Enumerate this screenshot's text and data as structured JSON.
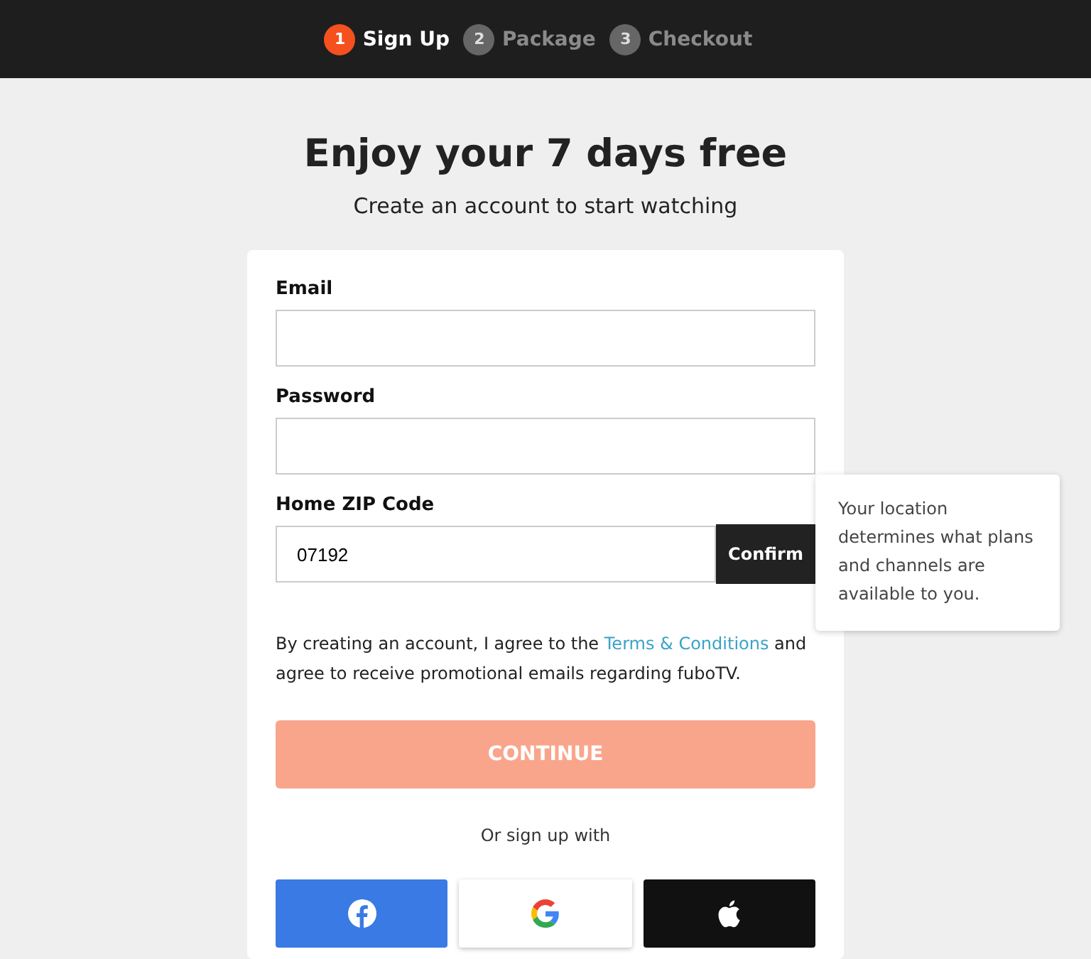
{
  "steps": [
    {
      "number": "1",
      "label": "Sign Up",
      "selected": true
    },
    {
      "number": "2",
      "label": "Package",
      "selected": false
    },
    {
      "number": "3",
      "label": "Checkout",
      "selected": false
    }
  ],
  "heading": "Enjoy your 7 days free",
  "subheading": "Create an account to start watching",
  "form": {
    "fields": [
      {
        "label": "Email"
      },
      {
        "label": "Password"
      },
      {
        "label": "Home ZIP Code",
        "value": "07192",
        "action": "Confirm",
        "tooltip": "Your location determines what plans and channels are available to you."
      }
    ],
    "terms": {
      "before": "By creating an account, I agree to the ",
      "link": "Terms & Conditions",
      "after": " and agree to receive promotional emails regarding fuboTV."
    },
    "continue_button": {
      "label": "CONTINUE",
      "disabled": true
    },
    "alt_signup": "Or sign up with",
    "social": [
      {
        "kind": "facebook"
      },
      {
        "kind": "google"
      },
      {
        "kind": "apple"
      }
    ]
  }
}
